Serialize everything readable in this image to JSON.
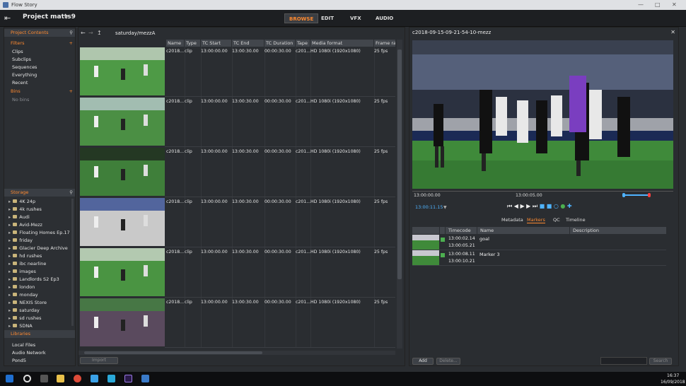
{
  "window": {
    "title": "Flow Story"
  },
  "topbar": {
    "project": "Project matts9",
    "tabs": [
      {
        "label": "BROWSE",
        "active": true
      },
      {
        "label": "EDIT",
        "active": false
      },
      {
        "label": "VFX",
        "active": false
      },
      {
        "label": "AUDIO",
        "active": false
      }
    ]
  },
  "left": {
    "project_contents": "Project Contents",
    "filters_label": "Filters",
    "filters": [
      "Clips",
      "Subclips",
      "Sequences",
      "Everything",
      "Recent"
    ],
    "bins_label": "Bins",
    "no_bins": "No bins",
    "storage_label": "Storage",
    "storage": [
      "4K 24p",
      "4k rushes",
      "Audi",
      "Avid-Mezz",
      "Floating Homes Ep.17",
      "friday",
      "Glacier Deep Archive",
      "hd rushes",
      "ibc nearline",
      "images",
      "Landlords S2 Ep3",
      "london",
      "monday",
      "NEXIS Store",
      "saturday",
      "sd rushes",
      "SDNA"
    ],
    "libraries_label": "Libraries",
    "libraries": [
      "Local Files",
      "Audio Network",
      "Pond5"
    ]
  },
  "middle": {
    "path": "saturday/mezzA",
    "columns": [
      "Name",
      "Type",
      "TC Start",
      "TC End",
      "TC Duration",
      "Tape",
      "Media format",
      "Frame ra"
    ],
    "rows": [
      [
        "c2018...",
        "clip",
        "13:00:00.00",
        "13:00:30.00",
        "00:00:30.00",
        "c201...",
        "HD 1080i (1920x1080)",
        "25 fps"
      ],
      [
        "c2018...",
        "clip",
        "13:00:00.00",
        "13:00:30.00",
        "00:00:30.00",
        "c201...",
        "HD 1080i (1920x1080)",
        "25 fps"
      ],
      [
        "c2018...",
        "clip",
        "13:00:00.00",
        "13:00:30.00",
        "00:00:30.00",
        "c201...",
        "HD 1080i (1920x1080)",
        "25 fps"
      ],
      [
        "c2018...",
        "clip",
        "13:00:00.00",
        "13:00:30.00",
        "00:00:30.00",
        "c201...",
        "HD 1080i (1920x1080)",
        "25 fps"
      ],
      [
        "c2018...",
        "clip",
        "13:00:00.00",
        "13:00:30.00",
        "00:00:30.00",
        "c201...",
        "HD 1080i (1920x1080)",
        "25 fps"
      ],
      [
        "c2018...",
        "clip",
        "13:00:00.00",
        "13:00:30.00",
        "00:00:30.00",
        "c201...",
        "HD 1080i (1920x1080)",
        "25 fps"
      ]
    ],
    "import_label": "Import"
  },
  "right": {
    "clip_title": "c2018-09-15-09-21-54-10-mezz",
    "tc_left": "13:00:00.00",
    "tc_mid": "13:00:05.00",
    "current_tc": "13:00:11.15",
    "tabs": [
      {
        "label": "Metadata",
        "active": false
      },
      {
        "label": "Markers",
        "active": true
      },
      {
        "label": "QC",
        "active": false
      },
      {
        "label": "Timeline",
        "active": false
      }
    ],
    "marker_columns": [
      "Timecode",
      "Name",
      "Description"
    ],
    "markers": [
      {
        "tc_in": "13:00:02.14",
        "tc_out": "13:00:05.21",
        "name": "goal",
        "description": ""
      },
      {
        "tc_in": "13:00:08.11",
        "tc_out": "13:00:10.21",
        "name": "Marker 3",
        "description": ""
      }
    ],
    "add_label": "Add",
    "delete_label": "Delete...",
    "search_label": "Search"
  },
  "taskbar": {
    "time": "16:37",
    "date": "16/09/2018"
  },
  "colors": {
    "accent": "#ff8a30",
    "active_blue": "#4fb3ff",
    "marker_green": "#4caf50"
  }
}
